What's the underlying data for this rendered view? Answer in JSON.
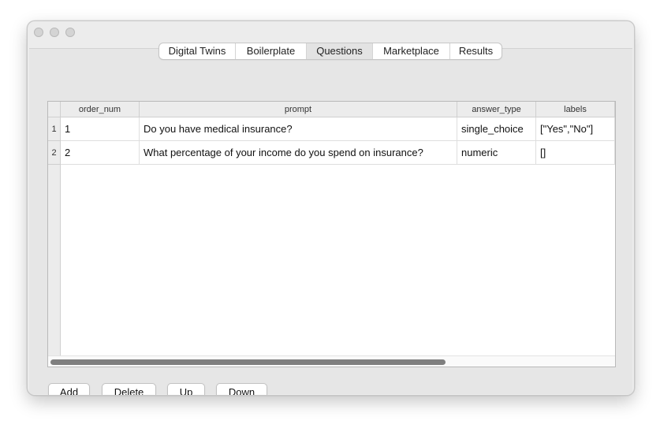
{
  "tabs": [
    {
      "label": "Digital Twins"
    },
    {
      "label": "Boilerplate"
    },
    {
      "label": "Questions",
      "selected": true
    },
    {
      "label": "Marketplace"
    },
    {
      "label": "Results"
    }
  ],
  "table": {
    "columns": [
      "order_num",
      "prompt",
      "answer_type",
      "labels"
    ],
    "rows": [
      {
        "row_number": "1",
        "order_num": "1",
        "prompt": "Do you have medical insurance?",
        "answer_type": "single_choice",
        "labels": "[\"Yes\",\"No\"]"
      },
      {
        "row_number": "2",
        "order_num": "2",
        "prompt": "What percentage of your income do you spend on insurance?",
        "answer_type": "numeric",
        "labels": "[]"
      }
    ]
  },
  "buttons": {
    "add": "Add",
    "delete": "Delete",
    "up": "Up",
    "down": "Down"
  },
  "colors": {
    "window_bg": "#ececec",
    "panel_bg": "#e6e6e6",
    "selected_tab": "#e3e3e3",
    "scroll_thumb": "#7f7f7f"
  }
}
